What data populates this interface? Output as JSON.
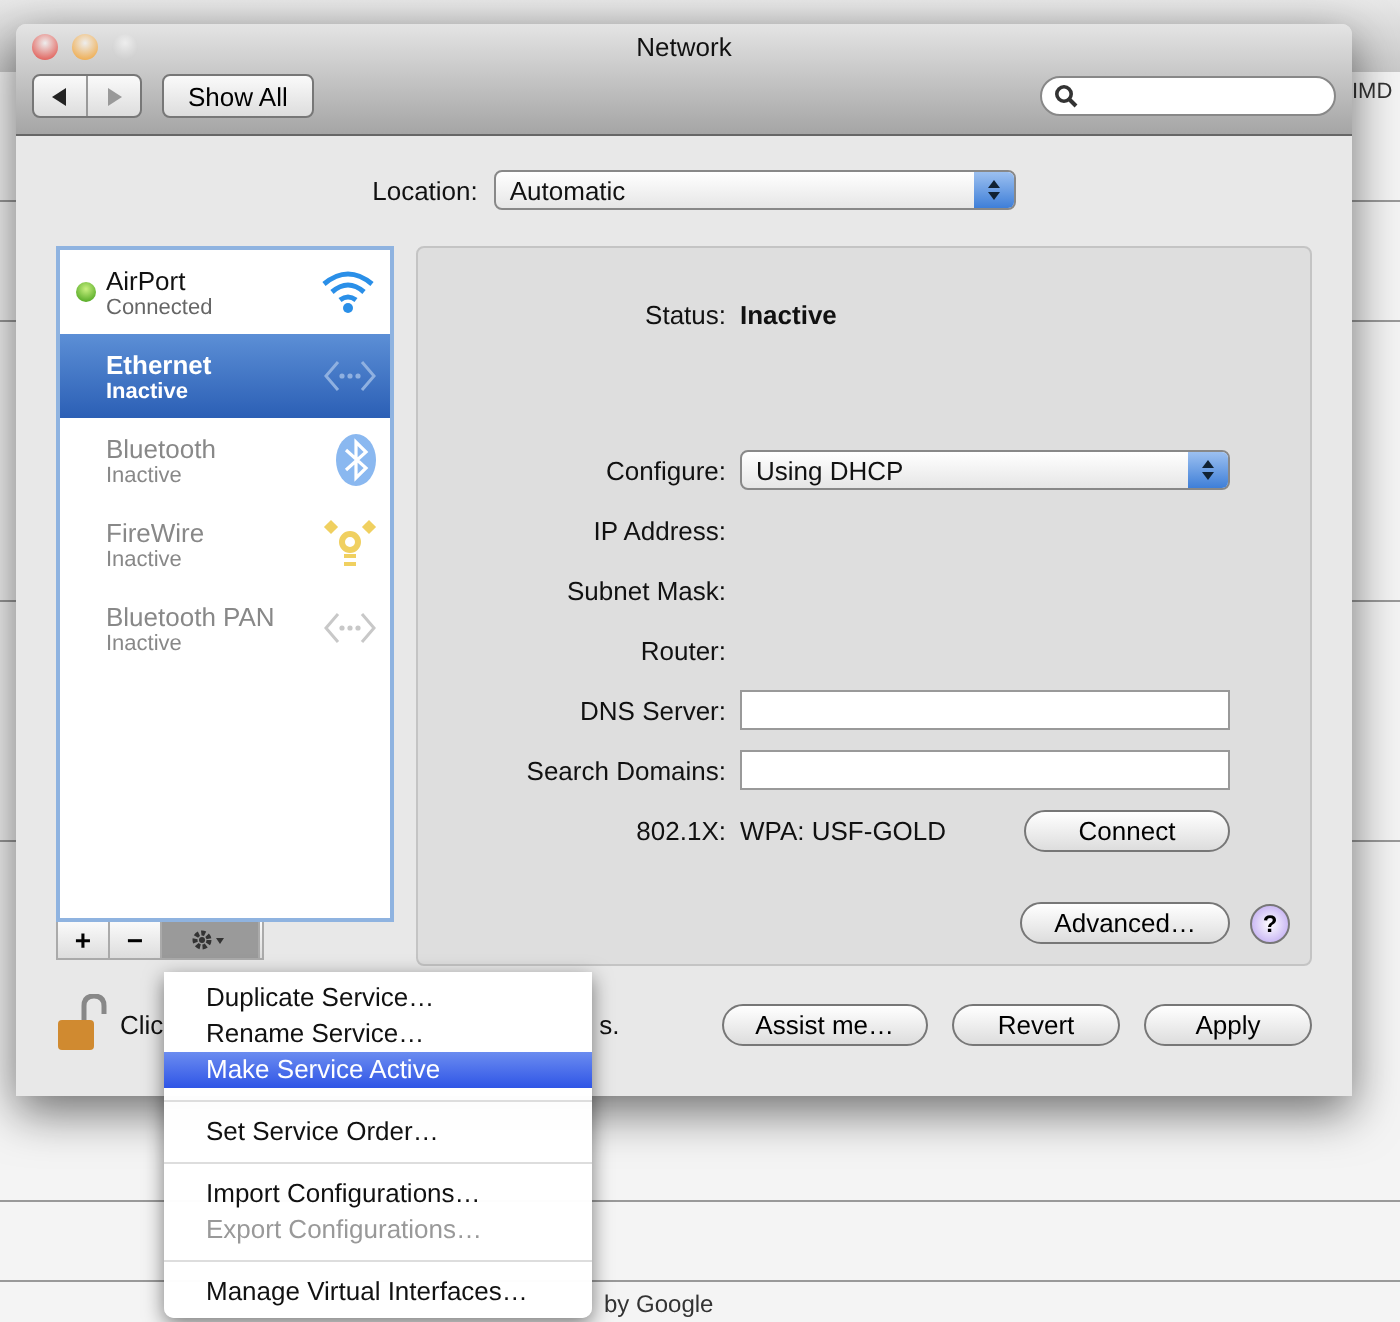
{
  "background": {
    "texts": [
      "IMD",
      "by Google"
    ]
  },
  "window": {
    "title": "Network",
    "show_all": "Show All"
  },
  "location": {
    "label": "Location:",
    "value": "Automatic"
  },
  "services": [
    {
      "name": "AirPort",
      "status": "Connected",
      "selected": false,
      "connected": true,
      "kind": "wifi"
    },
    {
      "name": "Ethernet",
      "status": "Inactive",
      "selected": true,
      "connected": false,
      "kind": "ethernet"
    },
    {
      "name": "Bluetooth",
      "status": "Inactive",
      "selected": false,
      "connected": false,
      "kind": "bluetooth"
    },
    {
      "name": "FireWire",
      "status": "Inactive",
      "selected": false,
      "connected": false,
      "kind": "firewire"
    },
    {
      "name": "Bluetooth PAN",
      "status": "Inactive",
      "selected": false,
      "connected": false,
      "kind": "ethernet"
    }
  ],
  "list_buttons": [
    "+",
    "−"
  ],
  "status": {
    "label": "Status:",
    "value": "Inactive"
  },
  "configure": {
    "label": "Configure:",
    "value": "Using DHCP"
  },
  "fields": [
    {
      "label": "IP Address:",
      "kind": "text"
    },
    {
      "label": "Subnet Mask:",
      "kind": "text"
    },
    {
      "label": "Router:",
      "kind": "text"
    },
    {
      "label": "DNS Server:",
      "kind": "input"
    },
    {
      "label": "Search Domains:",
      "kind": "input"
    }
  ],
  "dot1x": {
    "label": "802.1X:",
    "value": "WPA: USF-GOLD",
    "button": "Connect"
  },
  "advanced": "Advanced…",
  "help": "?",
  "lock_text": [
    "Clic",
    "s."
  ],
  "buttons": [
    "Assist me…",
    "Revert",
    "Apply"
  ],
  "menu": {
    "items": [
      {
        "label": "Duplicate Service…",
        "selected": false,
        "disabled": false,
        "separator_before": false
      },
      {
        "label": "Rename Service…",
        "selected": false,
        "disabled": false,
        "separator_before": false
      },
      {
        "label": "Make Service Active",
        "selected": true,
        "disabled": false,
        "separator_before": false
      },
      {
        "label": "Set Service Order…",
        "selected": false,
        "disabled": false,
        "separator_before": true
      },
      {
        "label": "Import Configurations…",
        "selected": false,
        "disabled": false,
        "separator_before": true
      },
      {
        "label": "Export Configurations…",
        "selected": false,
        "disabled": true,
        "separator_before": false
      },
      {
        "label": "Manage Virtual Interfaces…",
        "selected": false,
        "disabled": false,
        "separator_before": true
      }
    ]
  }
}
